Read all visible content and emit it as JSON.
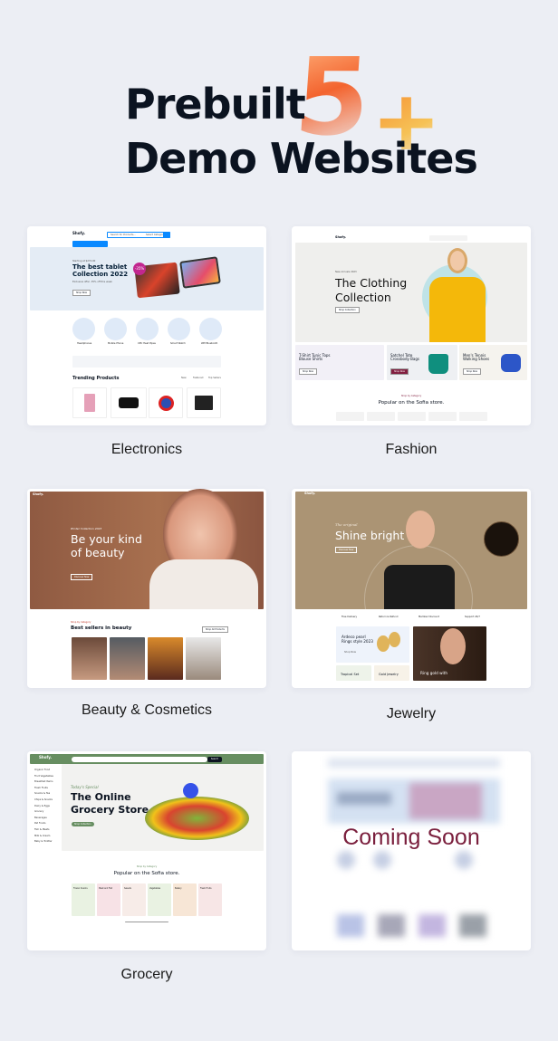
{
  "header": {
    "line1": "Prebuilt",
    "line2": "Demo Websites",
    "badge_number": "5",
    "badge_plus": "+",
    "badge_colors": [
      "#f3642f",
      "#f6c256"
    ]
  },
  "demos": [
    {
      "label": "Electronics",
      "site": {
        "logo": "Shofy.",
        "search_placeholder": "Search for Products...",
        "category": "Select Category",
        "hero_kicker": "Starting at $274.00",
        "hero_title_1": "The best tablet",
        "hero_title_2": "Collection 2022",
        "hero_sub": "Exclusive offer -35% off this week",
        "hero_button": "Shop Now",
        "discount": "-35%",
        "categories": [
          "Headphones",
          "Mobile Phone",
          "CPU Heat Pipes",
          "Smart Watch",
          "Wifi Bluetooth"
        ],
        "section_title": "Trending Products",
        "tabs": [
          "New",
          "Featured",
          "Top Sellers"
        ],
        "accent": "#0989ff"
      }
    },
    {
      "label": "Fashion",
      "site": {
        "logo": "Shofy.",
        "hero_kicker": "New Arrivals 2023",
        "hero_title_1": "The Clothing",
        "hero_title_2": "Collection",
        "hero_button": "Shop Collection",
        "banners": [
          "T-Shirt Tunic Tops Blouse Shirts",
          "Satchel Tote Crossbody Bags",
          "Men's Tennis Walking Shoes"
        ],
        "banner_button": "Shop Now",
        "section_kicker": "Shop by Category",
        "section_title": "Popular on the Sofia store."
      }
    },
    {
      "label": "Beauty & Cosmetics",
      "site": {
        "logo": "Shofy.",
        "hero_kicker": "Winter Collection 2023",
        "hero_title_1": "Be your kind",
        "hero_title_2": "of beauty",
        "hero_button": "Discover Now",
        "section_kicker": "Shop by Category",
        "section_title": "Best sellers in beauty",
        "section_button": "Shop All Products"
      }
    },
    {
      "label": "Jewelry",
      "site": {
        "logo": "Shofy.",
        "hero_kicker": "The original",
        "hero_title": "Shine bright",
        "hero_button": "Discover Now",
        "features": [
          "Free Delivery",
          "Return & Refund",
          "Member Discount",
          "Support 24/7"
        ],
        "promo_1_title_1": "Ardeco pearl",
        "promo_1_title_2": "Rings style 2023",
        "promo_1_button": "Shop Now",
        "promo_2": "Tropical Set",
        "promo_3": "Gold Jewelry",
        "promo_4": "Ring gold with"
      }
    },
    {
      "label": "Grocery",
      "site": {
        "logo": "Shofy.",
        "search_button": "Search",
        "sidebar": [
          "Organic Food",
          "Fruit Vegetables",
          "Breakfast Items",
          "Fresh Fruits",
          "Snacks & Tea",
          "Chips & Snacks",
          "Dairy & Eggs",
          "Grocery",
          "Beverages",
          "Pet Foods",
          "Fish & Meats",
          "Milk & Cream",
          "Baby & Toddler"
        ],
        "hero_kicker": "Today's Special",
        "hero_title_1": "The Online",
        "hero_title_2": "Grocery Store",
        "hero_button": "Shop Collection",
        "section_kicker": "Shop by Category",
        "section_title": "Popular on the Sofia store.",
        "tiles": [
          "Frozen Snacks",
          "Meat and Fish",
          "Sweets",
          "Vegetables",
          "Bakery",
          "Fresh Fruits"
        ],
        "accent": "#678e61"
      }
    },
    {
      "label": "",
      "site": {
        "overlay": "Coming Soon",
        "overlay_color": "#7a1f3d"
      }
    }
  ]
}
